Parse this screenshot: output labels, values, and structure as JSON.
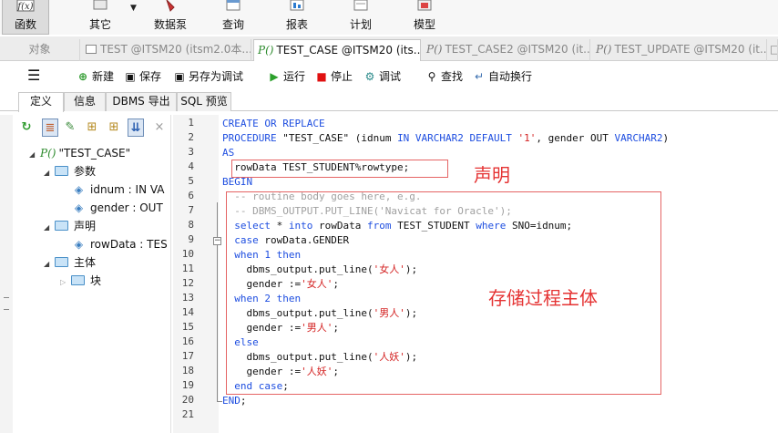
{
  "ribbon": {
    "items": [
      {
        "label": "函数",
        "icon": "function-icon"
      },
      {
        "label": "其它",
        "icon": "other-icon"
      },
      {
        "label": "数据泵",
        "icon": "data-pump-icon"
      },
      {
        "label": "查询",
        "icon": "query-icon"
      },
      {
        "label": "报表",
        "icon": "report-icon"
      },
      {
        "label": "计划",
        "icon": "schedule-icon"
      },
      {
        "label": "模型",
        "icon": "model-icon"
      }
    ]
  },
  "tabs": {
    "object_label": "对象",
    "items": [
      {
        "label": "TEST @ITSM20 (itsm2.0本..."
      },
      {
        "label": "TEST_CASE @ITSM20 (its..."
      },
      {
        "label": "TEST_CASE2 @ITSM20 (it..."
      },
      {
        "label": "TEST_UPDATE @ITSM20 (it..."
      }
    ]
  },
  "toolbar": {
    "new": "新建",
    "save": "保存",
    "save_as_debug": "另存为调试",
    "run": "运行",
    "stop": "停止",
    "debug": "调试",
    "find": "查找",
    "wrap": "自动换行"
  },
  "subtabs": [
    "定义",
    "信息",
    "DBMS 导出",
    "SQL 预览"
  ],
  "tree": {
    "root": "\"TEST_CASE\"",
    "params_label": "参数",
    "param1": "idnum : IN VA",
    "param2": "gender : OUT",
    "decl_label": "声明",
    "decl1": "rowData : TES",
    "body_label": "主体",
    "block_label": "块"
  },
  "editor": {
    "line_numbers": [
      "1",
      "2",
      "3",
      "4",
      "5",
      "6",
      "7",
      "8",
      "9",
      "10",
      "11",
      "12",
      "13",
      "14",
      "15",
      "16",
      "17",
      "18",
      "19",
      "20",
      "21"
    ],
    "lines": [
      [
        [
          "kw",
          "CREATE OR REPLACE"
        ]
      ],
      [
        [
          "kw",
          "PROCEDURE"
        ],
        [
          "t",
          " \"TEST_CASE\" (idnum "
        ],
        [
          "kw",
          "IN VARCHAR2 DEFAULT"
        ],
        [
          "t",
          " "
        ],
        [
          "str",
          "'1'"
        ],
        [
          "t",
          ", gender OUT "
        ],
        [
          "kw",
          "VARCHAR2"
        ],
        [
          "t",
          ")"
        ]
      ],
      [
        [
          "kw",
          "AS"
        ]
      ],
      [
        [
          "t",
          "  rowData TEST_STUDENT%rowtype;"
        ]
      ],
      [
        [
          "kw",
          "BEGIN"
        ]
      ],
      [
        [
          "cm",
          "  -- routine body goes here, e.g."
        ]
      ],
      [
        [
          "cm",
          "  -- DBMS_OUTPUT.PUT_LINE('Navicat for Oracle');"
        ]
      ],
      [
        [
          "t",
          "  "
        ],
        [
          "kw",
          "select"
        ],
        [
          "t",
          " * "
        ],
        [
          "kw",
          "into"
        ],
        [
          "t",
          " rowData "
        ],
        [
          "kw",
          "from"
        ],
        [
          "t",
          " TEST_STUDENT "
        ],
        [
          "kw",
          "where"
        ],
        [
          "t",
          " SNO=idnum;"
        ]
      ],
      [
        [
          "t",
          "  "
        ],
        [
          "kw",
          "case"
        ],
        [
          "t",
          " rowData.GENDER"
        ]
      ],
      [
        [
          "t",
          "  "
        ],
        [
          "kw",
          "when"
        ],
        [
          "t",
          " "
        ],
        [
          "num",
          "1"
        ],
        [
          "t",
          " "
        ],
        [
          "kw",
          "then"
        ]
      ],
      [
        [
          "t",
          "    dbms_output.put_line("
        ],
        [
          "str",
          "'女人'"
        ],
        [
          "t",
          ");"
        ]
      ],
      [
        [
          "t",
          "    gender :="
        ],
        [
          "str",
          "'女人'"
        ],
        [
          "t",
          ";"
        ]
      ],
      [
        [
          "t",
          "  "
        ],
        [
          "kw",
          "when"
        ],
        [
          "t",
          " "
        ],
        [
          "num",
          "2"
        ],
        [
          "t",
          " "
        ],
        [
          "kw",
          "then"
        ]
      ],
      [
        [
          "t",
          "    dbms_output.put_line("
        ],
        [
          "str",
          "'男人'"
        ],
        [
          "t",
          ");"
        ]
      ],
      [
        [
          "t",
          "    gender :="
        ],
        [
          "str",
          "'男人'"
        ],
        [
          "t",
          ";"
        ]
      ],
      [
        [
          "t",
          "  "
        ],
        [
          "kw",
          "else"
        ]
      ],
      [
        [
          "t",
          "    dbms_output.put_line("
        ],
        [
          "str",
          "'人妖'"
        ],
        [
          "t",
          ");"
        ]
      ],
      [
        [
          "t",
          "    gender :="
        ],
        [
          "str",
          "'人妖'"
        ],
        [
          "t",
          ";"
        ]
      ],
      [
        [
          "t",
          "  "
        ],
        [
          "kw",
          "end case"
        ],
        [
          "t",
          ";"
        ]
      ],
      [
        [
          "kw",
          "END"
        ],
        [
          "t",
          ";"
        ]
      ],
      [
        [
          "t",
          ""
        ]
      ]
    ]
  },
  "annotations": {
    "declaration": "声明",
    "body": "存储过程主体"
  },
  "colors": {
    "keyword": "#1e4ee0",
    "string": "#d42424",
    "comment": "#a0a0a0",
    "annotation": "#e53333"
  }
}
